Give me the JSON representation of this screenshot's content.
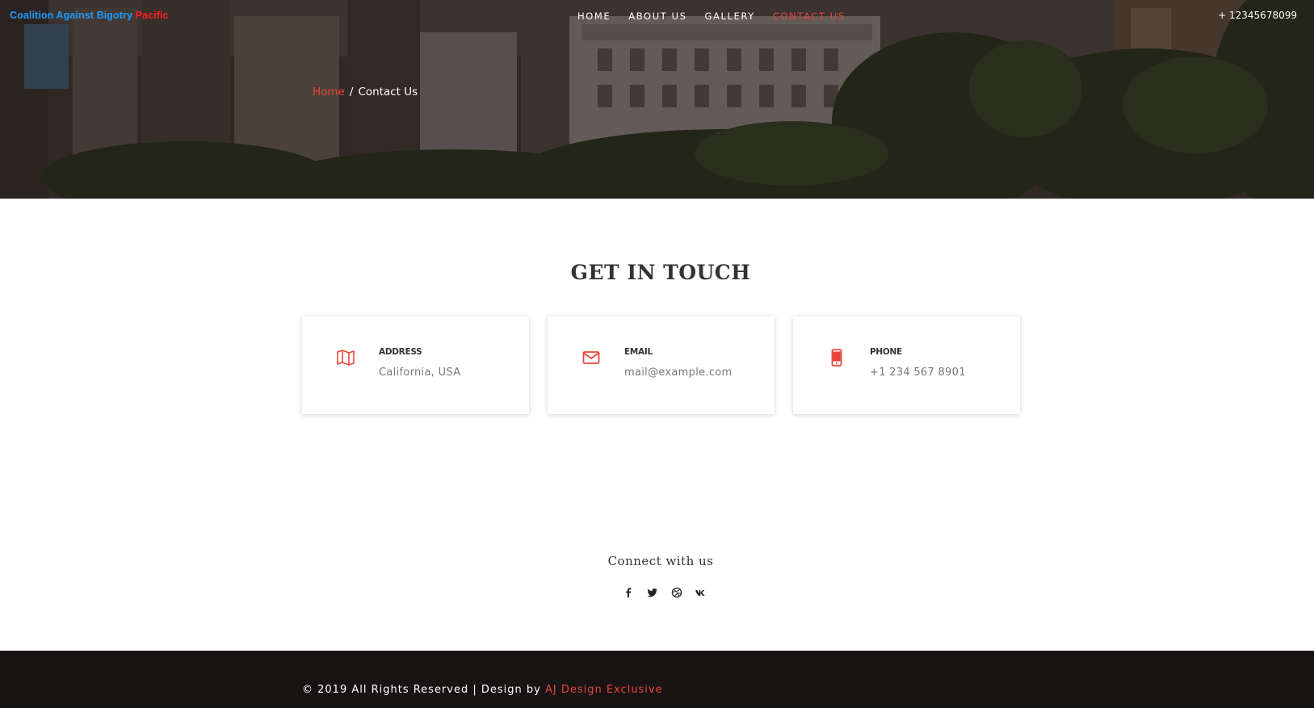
{
  "header": {
    "brand_part1": "Coalition Against Bigotry",
    "brand_part2": "Pacific",
    "nav": [
      {
        "label": "HOME",
        "active": false
      },
      {
        "label": "ABOUT US",
        "active": false
      },
      {
        "label": "GALLERY",
        "active": false
      },
      {
        "label": "CONTACT US",
        "active": true
      }
    ],
    "phone": "+ 12345678099"
  },
  "breadcrumb": {
    "home": "Home",
    "separator": "/",
    "current": "Contact Us"
  },
  "contact": {
    "heading": "GET IN TOUCH",
    "cards": [
      {
        "icon": "map-icon",
        "title": "ADDRESS",
        "value": "California, USA"
      },
      {
        "icon": "envelope-icon",
        "title": "EMAIL",
        "value": "mail@example.com"
      },
      {
        "icon": "mobile-phone-icon",
        "title": "PHONE",
        "value": "+1 234 567 8901"
      }
    ]
  },
  "social": {
    "heading": "Connect with us",
    "icons": [
      "facebook-icon",
      "twitter-icon",
      "dribbble-icon",
      "vk-icon"
    ]
  },
  "footer": {
    "copyright": "© 2019 All Rights Reserved | Design by",
    "credit": "AJ Design Exclusive"
  },
  "colors": {
    "accent": "#e8453c",
    "brand_blue": "#1e9bff",
    "brand_red": "#ff1e1e",
    "footer_bg": "#181414"
  }
}
